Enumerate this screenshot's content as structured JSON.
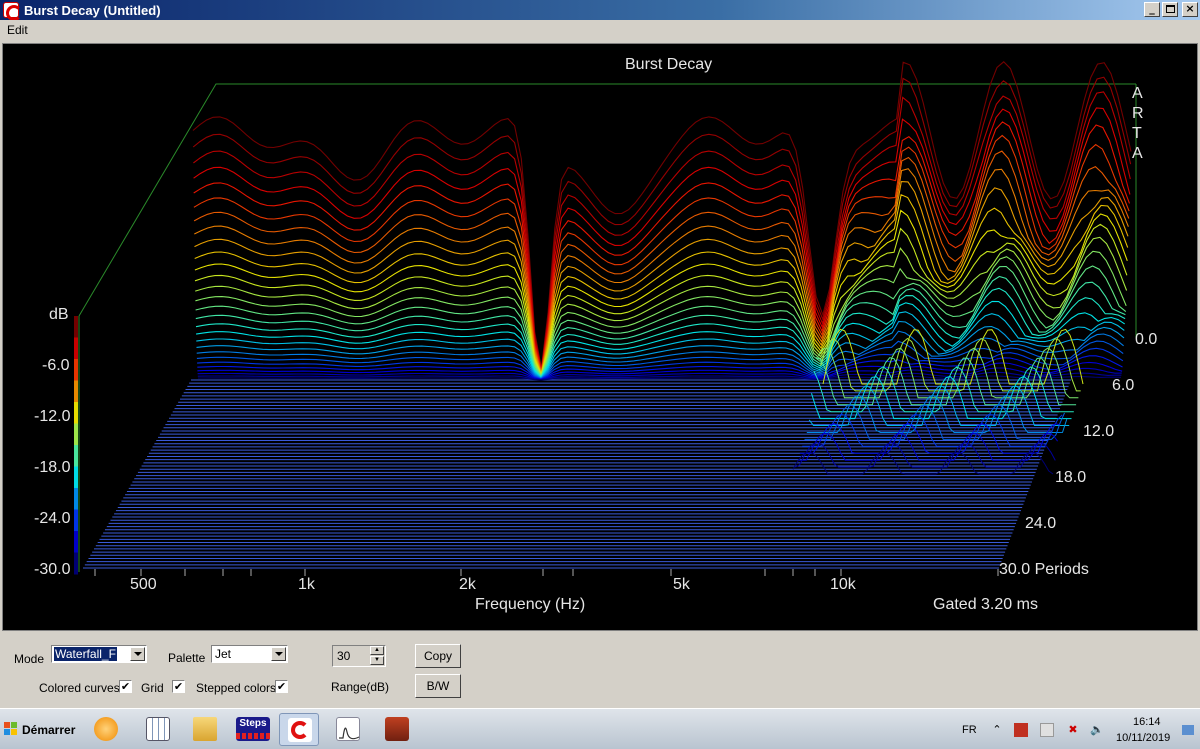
{
  "window": {
    "title": "Burst Decay  (Untitled)",
    "minimize_glyph": "_",
    "maximize_glyph": " ",
    "close_glyph": "×"
  },
  "menu": {
    "items": [
      "Edit"
    ]
  },
  "plot": {
    "title": "Burst Decay",
    "brand_letters": [
      "A",
      "R",
      "T",
      "A"
    ],
    "color_scale": {
      "label": "dB",
      "ticks": [
        "-6.0",
        "-12.0",
        "-18.0",
        "-24.0",
        "-30.0"
      ]
    },
    "x_axis": {
      "label": "Frequency (Hz)",
      "ticks": [
        "500",
        "1k",
        "2k",
        "5k",
        "10k"
      ]
    },
    "z_axis": {
      "ticks": [
        "0.0",
        "6.0",
        "12.0",
        "18.0",
        "24.0",
        "30.0 Periods"
      ]
    },
    "gating_note": "Gated 3.20 ms"
  },
  "chart_data": {
    "type": "waterfall",
    "title": "Burst Decay",
    "xlabel": "Frequency (Hz)",
    "x_scale": "log",
    "x_ticks": [
      "500",
      "1k",
      "2k",
      "5k",
      "10k"
    ],
    "z_label": "Periods",
    "z_ticks": [
      0,
      6,
      12,
      18,
      24,
      30
    ],
    "zlim": [
      0,
      30
    ],
    "color_label": "dB",
    "color_ticks": [
      -6,
      -12,
      -18,
      -24,
      -30
    ],
    "colorlim": [
      -30,
      0
    ],
    "palette": "Jet",
    "range_db": 30,
    "gated": "3.20 ms"
  },
  "controls": {
    "mode_label": "Mode",
    "mode_value": "Waterfall_F",
    "palette_label": "Palette",
    "palette_value": "Jet",
    "range_value": "30",
    "range_label": "Range(dB)",
    "copy_label": "Copy",
    "bw_label": "B/W",
    "colored_curves_label": "Colored curves",
    "grid_label": "Grid",
    "stepped_colors_label": "Stepped colors",
    "check_glyph": "✔"
  },
  "taskbar": {
    "start_label": "Démarrer",
    "steps_label": "Steps",
    "lang": "FR",
    "time": "16:14",
    "date": "10/11/2019"
  }
}
